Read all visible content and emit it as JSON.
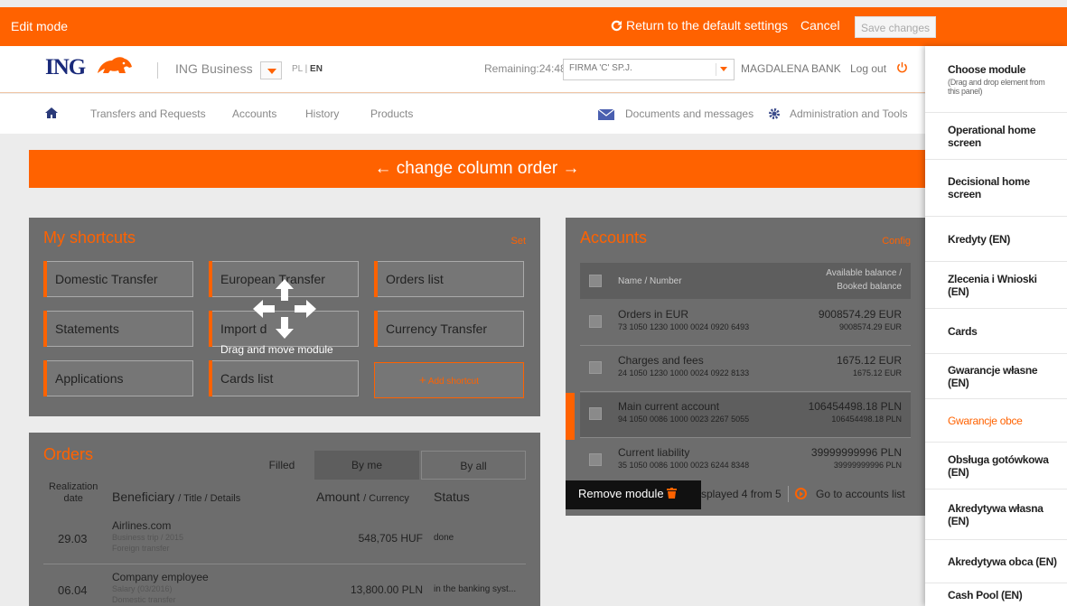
{
  "topbar": {
    "edit_mode": "Edit mode",
    "reset": "Return to the default settings",
    "cancel": "Cancel",
    "save": "Save changes"
  },
  "header": {
    "logo": "ING",
    "product": "ING Business",
    "lang_pl": "PL",
    "lang_sep": " | ",
    "lang_en": "EN",
    "remaining": "Remaining:24:48",
    "firm": "FIRMA 'C' SP.J.",
    "user": "MAGDALENA BANK",
    "logout": "Log out"
  },
  "nav": {
    "items": [
      "Transfers and Requests",
      "Accounts",
      "History",
      "Products"
    ],
    "documents": "Documents and messages",
    "admin": "Administration and Tools"
  },
  "column_order": "← change column order →",
  "shortcuts": {
    "title": "My shortcuts",
    "set": "Set",
    "items": [
      "Domestic Transfer",
      "European Transfer",
      "Orders list",
      "Statements",
      "Import d",
      "Currency Transfer",
      "Applications",
      "Cards list"
    ],
    "add": "Add shortcut",
    "drag_label": "Drag and move module"
  },
  "accounts": {
    "title": "Accounts",
    "config": "Config",
    "col_name": "Name / Number",
    "col_balance_1": "Available balance /",
    "col_balance_2": "Booked balance",
    "rows": [
      {
        "name": "Orders in EUR",
        "number": "73 1050 1230 1000 0024 0920 6493",
        "avail": "9008574.29 EUR",
        "booked": "9008574.29 EUR"
      },
      {
        "name": "Charges and fees",
        "number": "24 1050 1230 1000 0024 0922 8133",
        "avail": "1675.12 EUR",
        "booked": "1675.12 EUR"
      },
      {
        "name": "Main current account",
        "number": "94 1050 0086 1000 0023 2267 5055",
        "avail": "106454498.18 PLN",
        "booked": "106454498.18 PLN"
      },
      {
        "name": "Current liability",
        "number": "35 1050 0086 1000 0023 6244 8348",
        "avail": "39999999996 PLN",
        "booked": "39999999996 PLN"
      }
    ],
    "remove": "Remove module",
    "footer": "splayed 4 from 5",
    "go_to": "Go to accounts list"
  },
  "orders": {
    "title": "Orders",
    "tabs": [
      "Filled",
      "By me",
      "By all"
    ],
    "col_date_1": "Realization",
    "col_date_2": "date",
    "col_beneficiary": "Beneficiary",
    "col_beneficiary_sub": "/ Title / Details",
    "col_amount": "Amount",
    "col_amount_sub": "/ Currency",
    "col_status": "Status",
    "rows": [
      {
        "date": "29.03",
        "name": "Airlines.com",
        "title": "Business trip / 2015",
        "details": "Foreign transfer",
        "amount": "548,705 HUF",
        "status": "done"
      },
      {
        "date": "06.04",
        "name": "Company employee",
        "title": "Salary (03/2016)",
        "details": "Domestic transfer",
        "amount": "13,800.00 PLN",
        "status": "in the banking syst..."
      }
    ]
  },
  "panel": {
    "title": "Choose module",
    "hint": "(Drag and drop element from this panel)",
    "items": [
      "Operational home screen",
      "Decisional home screen",
      "Kredyty (EN)",
      "Zlecenia i Wnioski (EN)",
      "Cards",
      "Gwarancje własne (EN)",
      "Gwarancje obce",
      "Obsługa gotówkowa (EN)",
      "Akredytywa własna (EN)",
      "Akredytywa obca (EN)",
      "Cash Pool (EN)"
    ],
    "active": "Gwarancje obce"
  },
  "colors": {
    "accent": "#ff6200",
    "brand_blue": "#1a2a7a"
  }
}
